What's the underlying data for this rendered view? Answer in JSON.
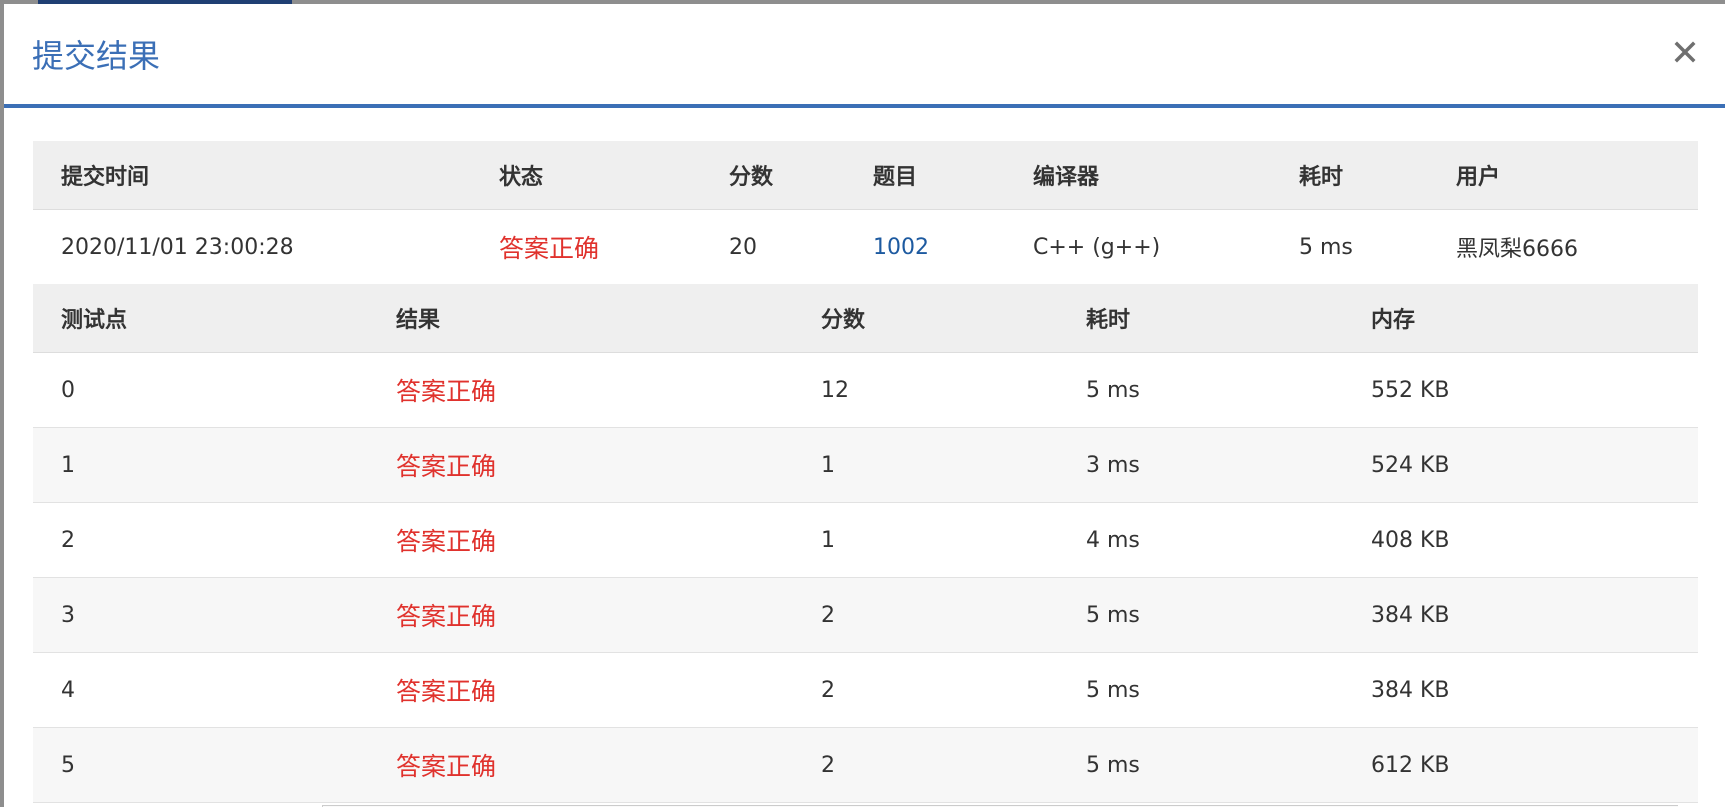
{
  "modal": {
    "title": "提交结果",
    "close_label": "×"
  },
  "summary": {
    "headers": [
      "提交时间",
      "状态",
      "分数",
      "题目",
      "编译器",
      "耗时",
      "用户"
    ],
    "row": {
      "time": "2020/11/01 23:00:28",
      "status": "答案正确",
      "score": "20",
      "problem": "1002",
      "compiler": "C++ (g++)",
      "elapsed": "5 ms",
      "user": "黑凤梨6666"
    }
  },
  "tests": {
    "headers": [
      "测试点",
      "结果",
      "分数",
      "耗时",
      "内存"
    ],
    "rows": [
      {
        "id": "0",
        "result": "答案正确",
        "score": "12",
        "time": "5 ms",
        "memory": "552 KB"
      },
      {
        "id": "1",
        "result": "答案正确",
        "score": "1",
        "time": "3 ms",
        "memory": "524 KB"
      },
      {
        "id": "2",
        "result": "答案正确",
        "score": "1",
        "time": "4 ms",
        "memory": "408 KB"
      },
      {
        "id": "3",
        "result": "答案正确",
        "score": "2",
        "time": "5 ms",
        "memory": "384 KB"
      },
      {
        "id": "4",
        "result": "答案正确",
        "score": "2",
        "time": "5 ms",
        "memory": "384 KB"
      },
      {
        "id": "5",
        "result": "答案正确",
        "score": "2",
        "time": "5 ms",
        "memory": "612 KB"
      }
    ]
  },
  "colors": {
    "accent": "#3b6fb6",
    "status_ok": "#e0322d",
    "link": "#1d5aa0"
  }
}
